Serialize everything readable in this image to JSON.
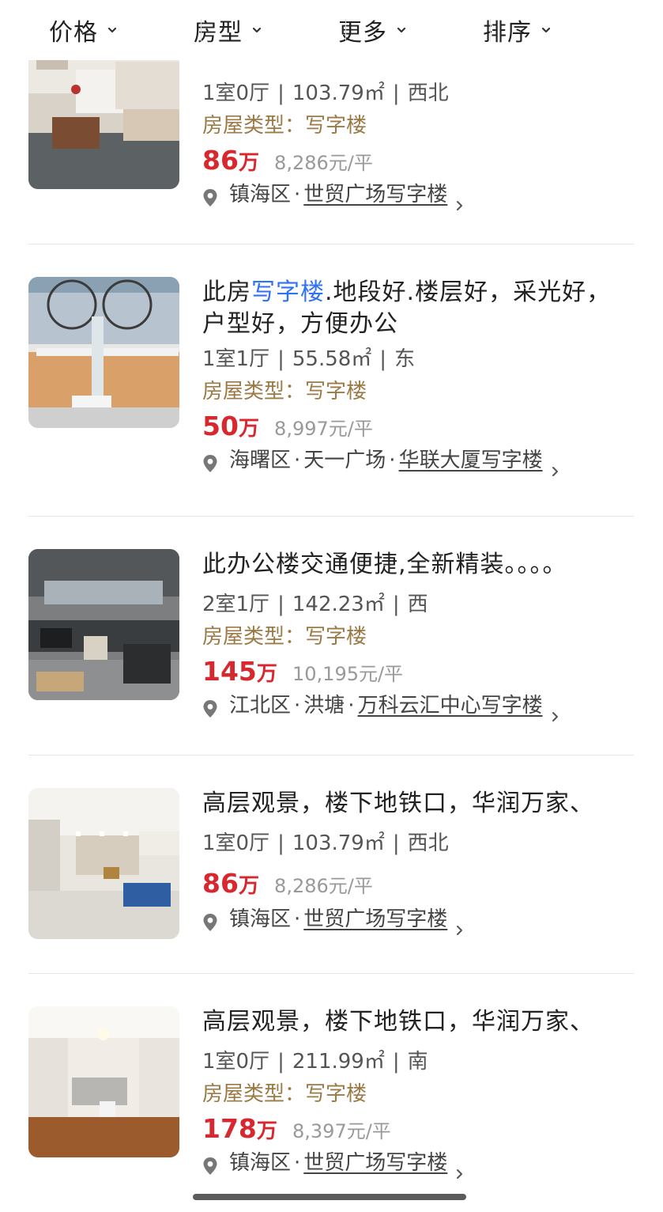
{
  "filters": [
    {
      "label": "价格"
    },
    {
      "label": "房型"
    },
    {
      "label": "更多"
    },
    {
      "label": "排序"
    }
  ],
  "listings": [
    {
      "title": "",
      "meta": {
        "rooms": "1室0厅",
        "area": "103.79㎡",
        "orientation": "西北"
      },
      "type_label": "房屋类型：写字楼",
      "price_value": "86",
      "price_unit": "万",
      "unit_price": "8,286元/平",
      "location": {
        "district": "镇海区",
        "area": "",
        "estate": "世贸广场写字楼"
      }
    },
    {
      "title_pre": "此房",
      "title_hl": "写字楼",
      "title_post": ".地段好.楼层好，采光好，户型好，方便办公",
      "meta": {
        "rooms": "1室1厅",
        "area": "55.58㎡",
        "orientation": "东"
      },
      "type_label": "房屋类型：写字楼",
      "price_value": "50",
      "price_unit": "万",
      "unit_price": "8,997元/平",
      "location": {
        "district": "海曙区",
        "area": "天一广场",
        "estate": "华联大厦写字楼"
      }
    },
    {
      "title": "此办公楼交通便捷,全新精装。。。。",
      "meta": {
        "rooms": "2室1厅",
        "area": "142.23㎡",
        "orientation": "西"
      },
      "type_label": "房屋类型：写字楼",
      "price_value": "145",
      "price_unit": "万",
      "unit_price": "10,195元/平",
      "location": {
        "district": "江北区",
        "area": "洪塘",
        "estate": "万科云汇中心写字楼"
      }
    },
    {
      "title": "高层观景，楼下地铁口，华润万家、",
      "meta": {
        "rooms": "1室0厅",
        "area": "103.79㎡",
        "orientation": "西北"
      },
      "price_value": "86",
      "price_unit": "万",
      "unit_price": "8,286元/平",
      "location": {
        "district": "镇海区",
        "area": "",
        "estate": "世贸广场写字楼"
      }
    },
    {
      "title": "高层观景，楼下地铁口，华润万家、",
      "meta": {
        "rooms": "1室0厅",
        "area": "211.99㎡",
        "orientation": "南"
      },
      "type_label": "房屋类型：写字楼",
      "price_value": "178",
      "price_unit": "万",
      "unit_price": "8,397元/平",
      "location": {
        "district": "镇海区",
        "area": "",
        "estate": "世贸广场写字楼"
      }
    }
  ],
  "colors": {
    "price": "#d7282f",
    "type": "#9b7a45",
    "highlight": "#3072f6"
  }
}
